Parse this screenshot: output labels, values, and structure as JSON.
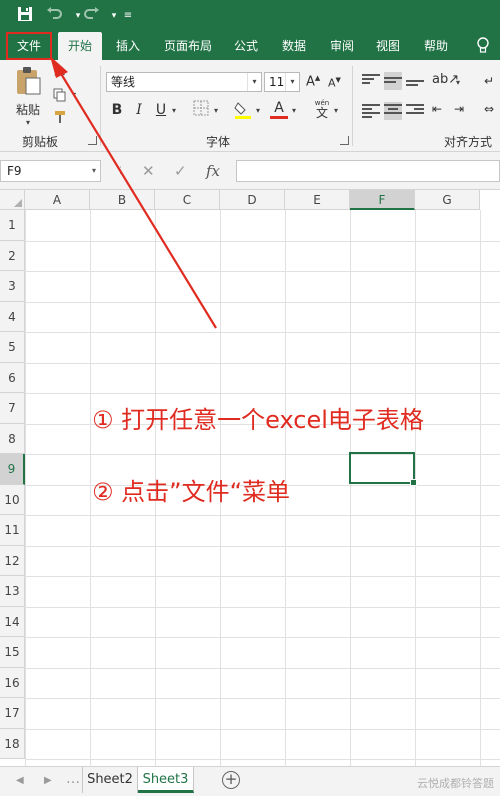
{
  "quick_access": {
    "save_icon": "save-icon",
    "undo_icon": "undo-icon",
    "redo_icon": "redo-icon",
    "customize_icon": "chevron-down-icon"
  },
  "tabs": [
    {
      "label": "文件"
    },
    {
      "label": "开始"
    },
    {
      "label": "插入"
    },
    {
      "label": "页面布局"
    },
    {
      "label": "公式"
    },
    {
      "label": "数据"
    },
    {
      "label": "审阅"
    },
    {
      "label": "视图"
    },
    {
      "label": "帮助"
    }
  ],
  "ribbon": {
    "clipboard": {
      "paste_label": "粘贴",
      "group_label": "剪贴板"
    },
    "font": {
      "font_name": "等线",
      "font_size": "11",
      "grow": "A",
      "shrink": "A",
      "bold": "B",
      "italic": "I",
      "underline": "U",
      "font_color_letter": "A",
      "wen": "wén",
      "wen_char": "文",
      "group_label": "字体"
    },
    "alignment": {
      "group_label": "对齐方式"
    }
  },
  "formula_bar": {
    "name_box": "F9",
    "cancel": "✕",
    "enter": "✓",
    "fx": "fx",
    "value": ""
  },
  "grid": {
    "columns": [
      "A",
      "B",
      "C",
      "D",
      "E",
      "F",
      "G"
    ],
    "rows": [
      "1",
      "2",
      "3",
      "4",
      "5",
      "6",
      "7",
      "8",
      "9",
      "10",
      "11",
      "12",
      "13",
      "14",
      "15",
      "16",
      "17",
      "18"
    ],
    "selected_cell": "F9"
  },
  "annotations": {
    "step1": "① 打开任意一个excel电子表格",
    "step2": "② 点击”文件“菜单"
  },
  "sheets": {
    "tabs": [
      {
        "label": "Sheet2"
      },
      {
        "label": "Sheet3"
      }
    ],
    "active": "Sheet3",
    "add_label": "+"
  },
  "watermark": "云悦成都铃答题",
  "colors": {
    "excel_green": "#217346",
    "highlight_red": "#e02b20"
  }
}
